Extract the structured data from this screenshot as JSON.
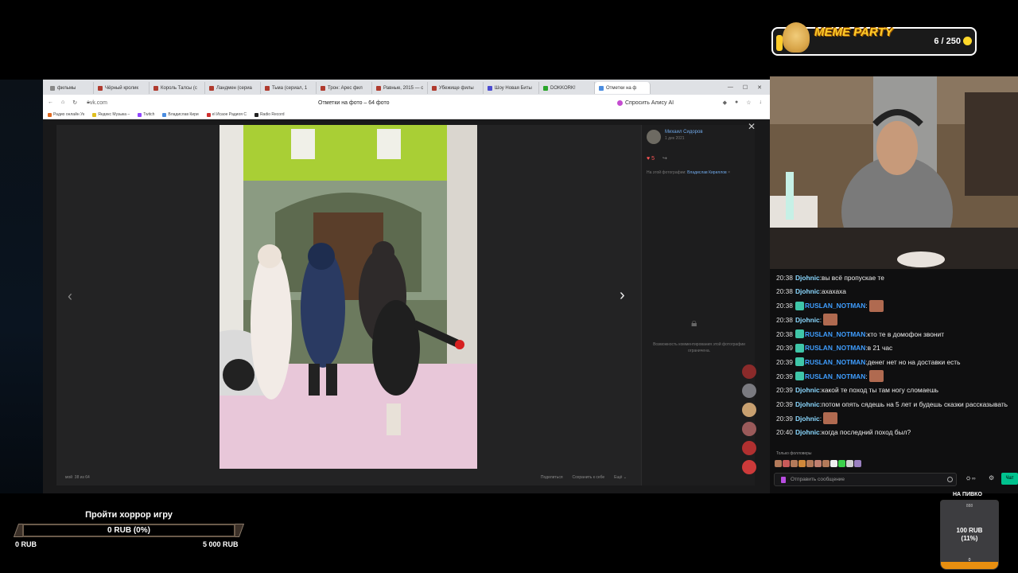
{
  "browser": {
    "tabs": [
      {
        "label": "фильмы",
        "color": "#888888"
      },
      {
        "label": "Чёрный кролик",
        "color": "#b03a2e"
      },
      {
        "label": "Король Талсы (с",
        "color": "#b03a2e"
      },
      {
        "label": "Ландмен (сериа",
        "color": "#b03a2e"
      },
      {
        "label": "Тьма (сериал, 1",
        "color": "#b03a2e"
      },
      {
        "label": "Трон: Арес фил",
        "color": "#b03a2e"
      },
      {
        "label": "Равные, 2015 — с",
        "color": "#b03a2e"
      },
      {
        "label": "Убежище филы",
        "color": "#b03a2e"
      },
      {
        "label": "Шоу Новая Биты",
        "color": "#4b4bd1"
      },
      {
        "label": "DOKKORK!",
        "color": "#2aa52a"
      },
      {
        "label": "Отметки на ф",
        "color": "#4b8de0",
        "active": true
      }
    ],
    "address": "vk.com",
    "page_title": "Отметки на фото – 64 фото",
    "alice_label": "Спросить Алису AI",
    "bookmarks": [
      {
        "label": "Радио онлайн Ук",
        "color": "#e06a20"
      },
      {
        "label": "Яндекс Музыка –",
        "color": "#e0c020"
      },
      {
        "label": "Twitch",
        "color": "#9146ff"
      },
      {
        "label": "Владислав Кири",
        "color": "#4b8de0"
      },
      {
        "label": "el Исаое Радиоя С",
        "color": "#d03030"
      },
      {
        "label": "Radio Record",
        "color": "#222222"
      }
    ]
  },
  "viewer": {
    "author_name": "Михаил Сидоров",
    "author_date": "1 дек 2021",
    "likes": "5",
    "tagged_prefix": "На этой фотографии:",
    "tagged_name": "Владислав Кириллов",
    "comments_closed": "Возможность комментирования этой фотографии ограничена.",
    "owner": "мой",
    "counter": "38 из 64",
    "share": "Поделиться",
    "save": "Сохранить к себе",
    "more": "Ещё"
  },
  "meme": {
    "title": "MEME PARTY",
    "count": "6 / 250",
    "progress": 0.024
  },
  "chat": {
    "messages": [
      {
        "time": "20:38",
        "user": "Djohnic",
        "badge": false,
        "text": "вы всё пропускае те"
      },
      {
        "time": "20:38",
        "user": "Djohnic",
        "badge": false,
        "text": "ахахаха"
      },
      {
        "time": "20:38",
        "user": "RUSLAN_NOTMAN",
        "badge": true,
        "text": "",
        "emote": true
      },
      {
        "time": "20:38",
        "user": "Djohnic",
        "badge": false,
        "text": "",
        "emote": true
      },
      {
        "time": "20:38",
        "user": "RUSLAN_NOTMAN",
        "badge": true,
        "text": "кто те в домофон звонит"
      },
      {
        "time": "20:39",
        "user": "RUSLAN_NOTMAN",
        "badge": true,
        "text": "в 21 час"
      },
      {
        "time": "20:39",
        "user": "RUSLAN_NOTMAN",
        "badge": true,
        "text": "денег нет но на доставки есть"
      },
      {
        "time": "20:39",
        "user": "RUSLAN_NOTMAN",
        "badge": true,
        "text": "",
        "emote": true
      },
      {
        "time": "20:39",
        "user": "Djohnic",
        "badge": false,
        "text": "какой те поход ты там ногу сломаешь"
      },
      {
        "time": "20:39",
        "user": "Djohnic",
        "badge": false,
        "text": "потом опять сядешь на 5 лет и будешь сказки рассказывать"
      },
      {
        "time": "20:39",
        "user": "Djohnic",
        "badge": false,
        "text": "",
        "emote": true
      },
      {
        "time": "20:40",
        "user": "Djohnic",
        "badge": false,
        "text": "когда последний поход был?"
      }
    ],
    "followers_only": "Только фолловеры",
    "input_placeholder": "Отправить сообщение",
    "points": "∞",
    "send_label": "Чат"
  },
  "goal": {
    "title": "Пройти хоррор игру",
    "current": "0 RUB (0%)",
    "min": "0 RUB",
    "max": "5 000 RUB",
    "progress": 0
  },
  "beer": {
    "title": "НА ПИВКО",
    "cap": "888",
    "value": "100 RUB\n(11%)",
    "zero": "0",
    "progress": 0.11
  }
}
